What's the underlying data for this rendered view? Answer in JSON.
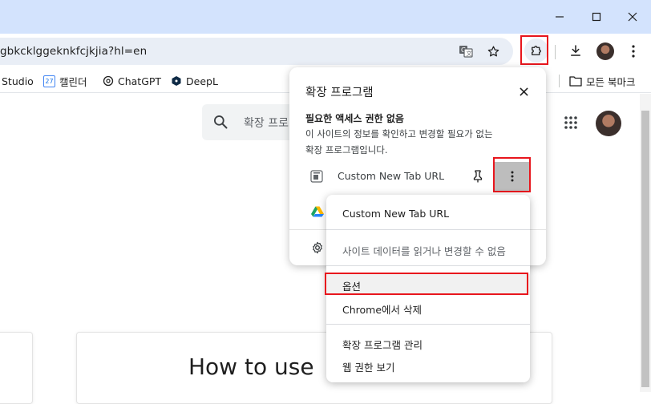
{
  "window": {
    "minimize_icon": "minimize-icon",
    "maximize_icon": "maximize-icon",
    "close_icon": "close-icon"
  },
  "toolbar": {
    "url": "gbkcklggeknkfcjkjia?hl=en",
    "translate_icon": "translate-icon",
    "star_icon": "star-icon",
    "extensions_icon": "puzzle-icon",
    "download_icon": "download-icon",
    "menu_icon": "kebab-menu-icon"
  },
  "bookmarks": {
    "items": [
      {
        "label": "Studio",
        "icon": ""
      },
      {
        "label": "캘린더",
        "icon": "calendar-icon",
        "badge": "27"
      },
      {
        "label": "ChatGPT",
        "icon": "chatgpt-icon"
      },
      {
        "label": "DeepL",
        "icon": "deepl-icon"
      }
    ],
    "all_bookmarks": "모든 북마크"
  },
  "page": {
    "search_placeholder": "확장 프로",
    "card_heading": "How to use"
  },
  "extensions_panel": {
    "title": "확장 프로그램",
    "section_title": "필요한 액세스 권한 없음",
    "section_desc_1": "이 사이트의 정보를 확인하고 변경할 필요가 없는",
    "section_desc_2": "확장 프로그램입니다.",
    "extension_name": "Custom New Tab URL"
  },
  "context_menu": {
    "item_name": "Custom New Tab URL",
    "item_permission": "사이트 데이터를 읽거나 변경할 수 없음",
    "item_options": "옵션",
    "item_remove": "Chrome에서 삭제",
    "item_manage": "확장 프로그램 관리",
    "item_view_permissions": "웹 권한 보기"
  },
  "colors": {
    "titlebar": "#d3e3fd",
    "omnibox": "#e9eef6",
    "highlight": "#e8161d",
    "drive_green": "#1ea362",
    "drive_yellow": "#ffba00",
    "drive_blue": "#2684fc"
  }
}
